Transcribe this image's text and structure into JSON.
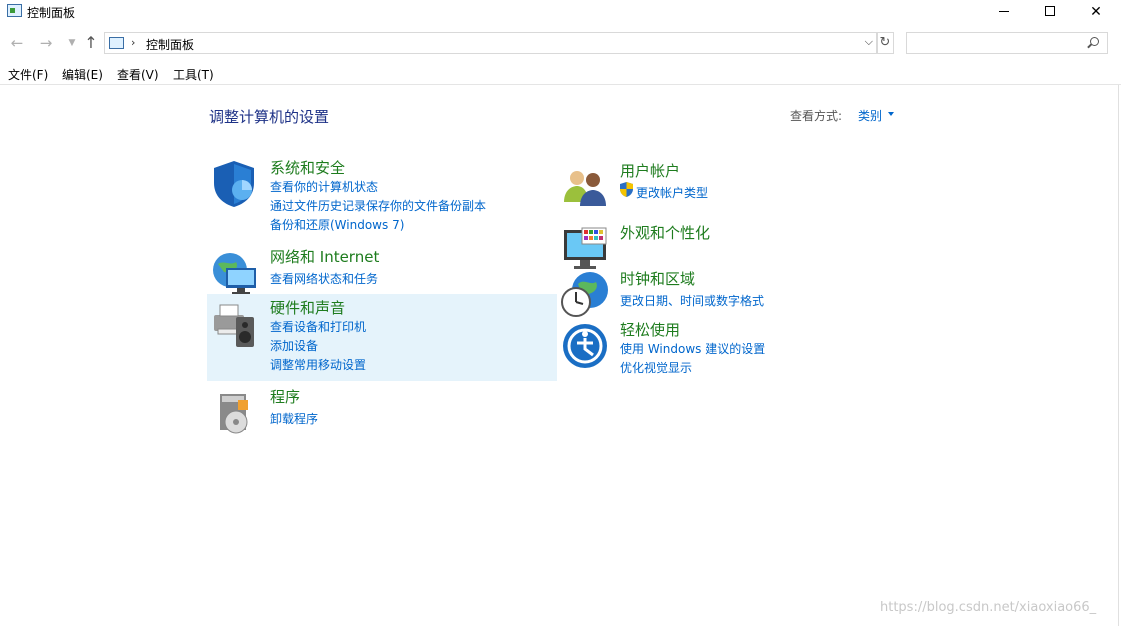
{
  "window": {
    "title": "控制面板"
  },
  "address": {
    "path": "控制面板",
    "search_placeholder": ""
  },
  "menu": [
    "文件(F)",
    "编辑(E)",
    "查看(V)",
    "工具(T)"
  ],
  "main": {
    "heading": "调整计算机的设置",
    "view_by_label": "查看方式:",
    "view_by_value": "类别"
  },
  "categories": [
    {
      "title": "系统和安全",
      "links": [
        "查看你的计算机状态",
        "通过文件历史记录保存你的文件备份副本",
        "备份和还原(Windows 7)"
      ],
      "icon": "shield-icon"
    },
    {
      "title": "网络和 Internet",
      "links": [
        "查看网络状态和任务"
      ],
      "icon": "network-globe-icon"
    },
    {
      "title": "硬件和声音",
      "links": [
        "查看设备和打印机",
        "添加设备",
        "调整常用移动设置"
      ],
      "icon": "printer-speaker-icon"
    },
    {
      "title": "程序",
      "links": [
        "卸载程序"
      ],
      "icon": "programs-disc-icon"
    },
    {
      "title": "用户帐户",
      "links": [
        "更改帐户类型"
      ],
      "icon": "users-icon"
    },
    {
      "title": "外观和个性化",
      "links": [],
      "icon": "monitor-palette-icon"
    },
    {
      "title": "时钟和区域",
      "links": [
        "更改日期、时间或数字格式"
      ],
      "icon": "clock-globe-icon"
    },
    {
      "title": "轻松使用",
      "links": [
        "使用 Windows 建议的设置",
        "优化视觉显示"
      ],
      "icon": "accessibility-icon"
    }
  ],
  "watermark": "https://blog.csdn.net/xiaoxiao66_",
  "colors": {
    "category_title": "#1e7c1e",
    "link": "#0066cc",
    "heading": "#1e3287",
    "highlight": "#e5f3fb"
  }
}
